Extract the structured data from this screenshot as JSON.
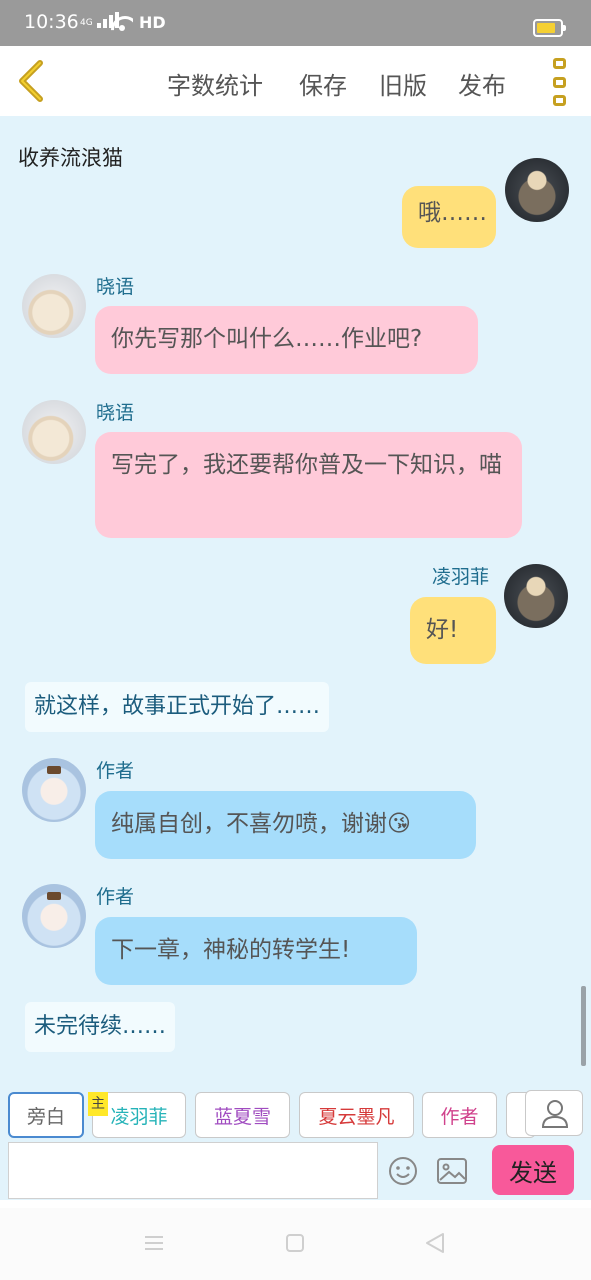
{
  "status_bar": {
    "time": "10:36",
    "network": "4G",
    "hd": "HD"
  },
  "top_bar": {
    "word_count": "字数统计",
    "save": "保存",
    "old_version": "旧版",
    "publish": "发布"
  },
  "story": {
    "title": "收养流浪猫"
  },
  "messages": [
    {
      "type": "right",
      "speaker": "",
      "text": "哦……",
      "bubble_color": "#ffe07a"
    },
    {
      "type": "left",
      "speaker": "晓语",
      "text": "你先写那个叫什么……作业吧?",
      "bubble_color": "#ffcad9"
    },
    {
      "type": "left",
      "speaker": "晓语",
      "text": "写完了，我还要帮你普及一下知识，喵",
      "bubble_color": "#ffcad9"
    },
    {
      "type": "right",
      "speaker": "凌羽菲",
      "text": "好!",
      "bubble_color": "#ffe07a"
    },
    {
      "type": "narration",
      "text": "就这样，故事正式开始了……"
    },
    {
      "type": "left",
      "speaker": "作者",
      "text": "纯属自创，不喜勿喷，谢谢",
      "emoji": "😘",
      "bubble_color": "#a6ddfb"
    },
    {
      "type": "left",
      "speaker": "作者",
      "text": "下一章，神秘的转学生!",
      "bubble_color": "#a6ddfb"
    },
    {
      "type": "narration",
      "text": "未完待续……"
    }
  ],
  "characters": [
    {
      "label": "旁白",
      "selected": true,
      "color": "#666666"
    },
    {
      "label": "凌羽菲",
      "tag": "主",
      "color": "#25b3b8"
    },
    {
      "label": "蓝夏雪",
      "color": "#a04cc0"
    },
    {
      "label": "夏云墨凡",
      "color": "#d63a3a"
    },
    {
      "label": "作者",
      "color": "#d0428c"
    }
  ],
  "composer": {
    "input_value": "",
    "send": "发送"
  },
  "colors": {
    "accent": "#c6a020",
    "send": "#f8599a",
    "chat_bg": "#e2f3fb"
  }
}
